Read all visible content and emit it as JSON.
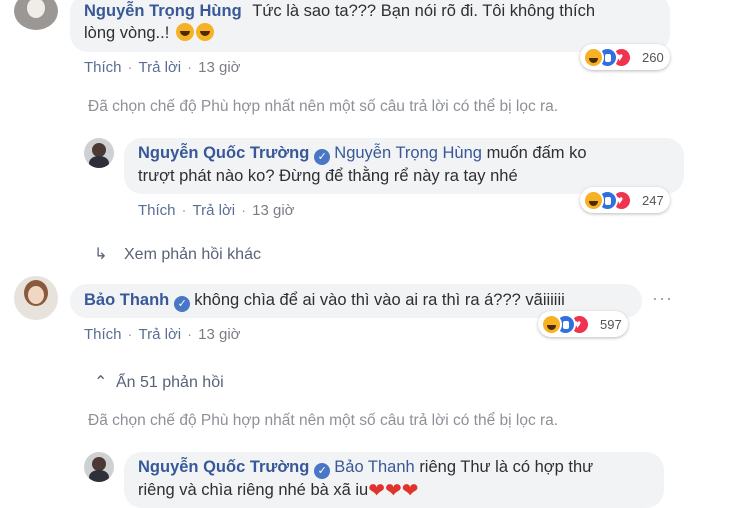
{
  "comments": [
    {
      "author": "Nguyễn Trọng Hùng",
      "text_line1": "Tức là sao ta??? Bạn nói rõ đi. Tôi không thích",
      "text_line2": "lòng vòng..!",
      "like_label": "Thích",
      "reply_label": "Trả lời",
      "time": "13 giờ",
      "reaction_count": "260"
    },
    {
      "author": "Nguyễn Quốc Trường",
      "mention": "Nguyễn Trọng Hùng",
      "text_line1": "muốn đấm ko",
      "text_line2": "trượt phát nào ko? Đừng để thằng rể này ra tay nhé",
      "like_label": "Thích",
      "reply_label": "Trả lời",
      "time": "13 giờ",
      "reaction_count": "247"
    },
    {
      "author": "Bảo Thanh",
      "text_line1": "không chìa để ai vào thì vào ai ra thì ra á??? vãiiiiii",
      "like_label": "Thích",
      "reply_label": "Trả lời",
      "time": "13 giờ",
      "reaction_count": "597"
    },
    {
      "author": "Nguyễn Quốc Trường",
      "mention": "Bảo Thanh",
      "text_line1": "riêng Thư là có hợp thư",
      "text_line2": "riêng và chìa riêng nhé bà xã iu"
    }
  ],
  "filter_notice": "Đã chọn chế độ Phù hợp nhất nên một số câu trả lời có thể bị lọc ra.",
  "view_more_replies": "Xem phản hồi khác",
  "hide_replies": "Ẩn 51 phản hồi",
  "icons": {
    "verified": "verified-badge-icon",
    "haha": "haha-reaction-icon",
    "like": "like-reaction-icon",
    "love": "love-reaction-icon",
    "reply_arrow": "reply-arrow-icon",
    "chevron_up": "chevron-up-icon",
    "heart": "heart-emoji-icon"
  }
}
